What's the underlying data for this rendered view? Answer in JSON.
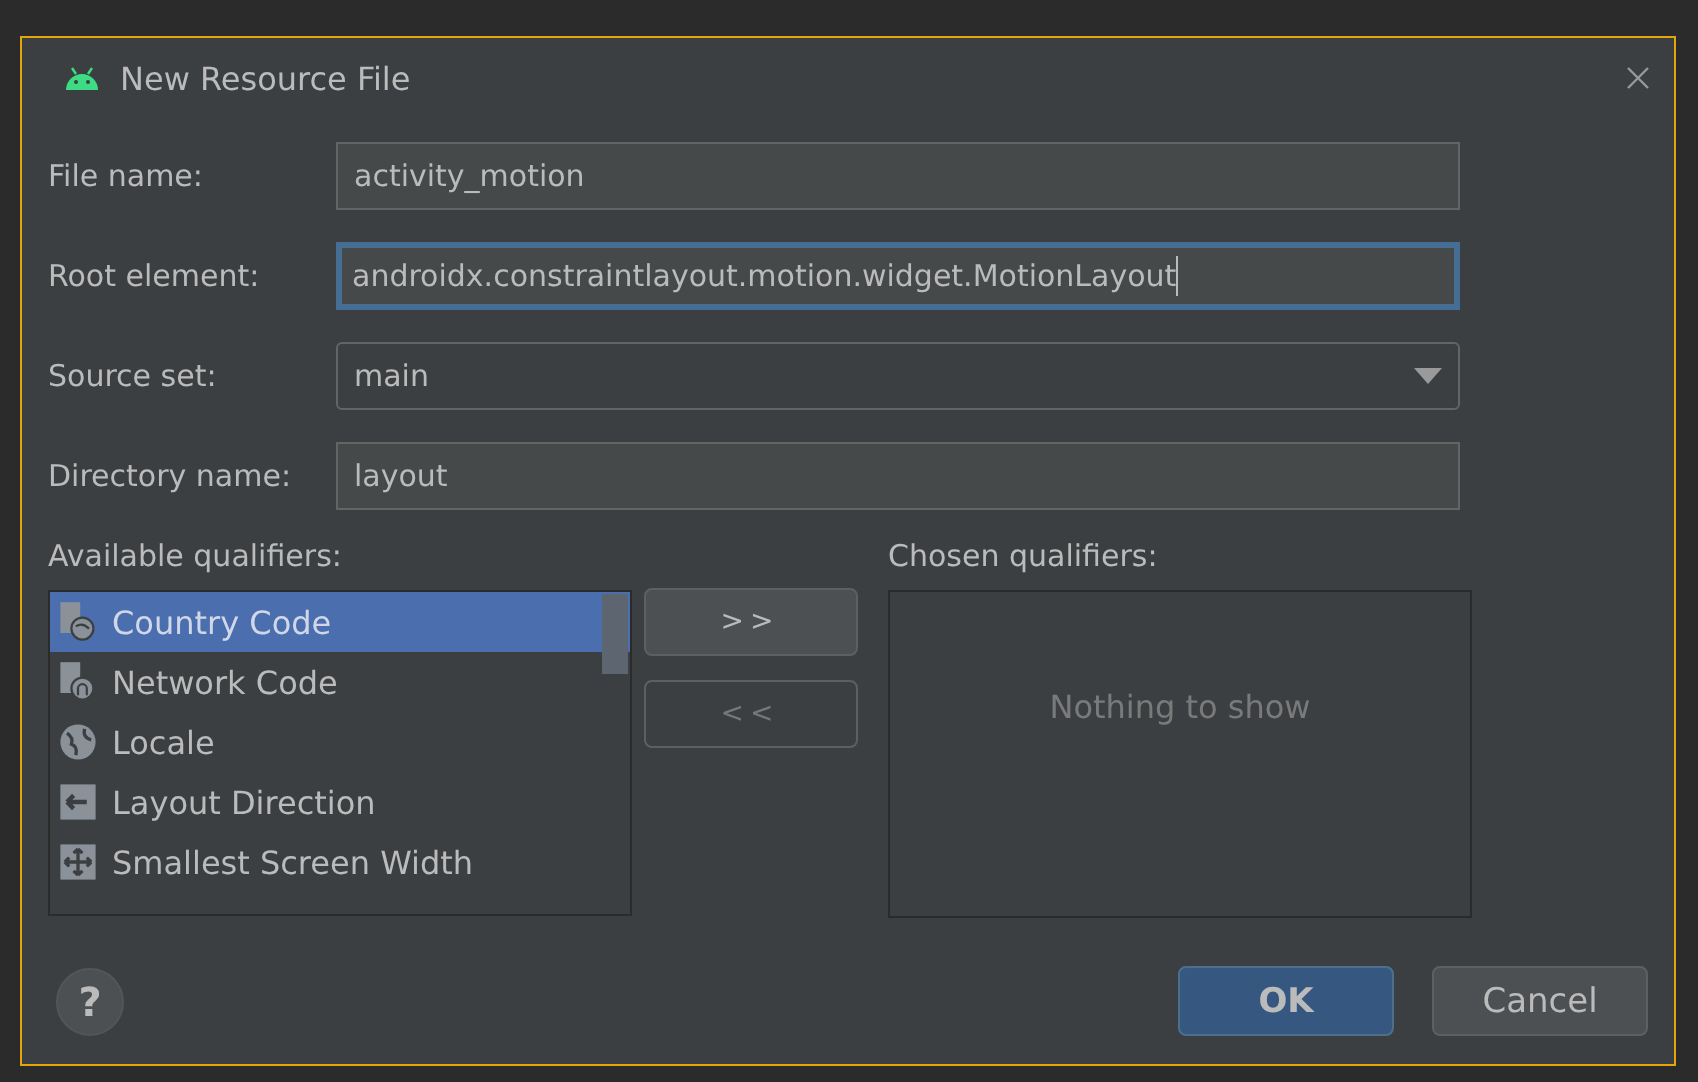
{
  "window": {
    "title": "New Resource File"
  },
  "fields": [
    {
      "label": "File name:",
      "kind": "text",
      "value": "activity_motion",
      "focused": false
    },
    {
      "label": "Root element:",
      "kind": "text",
      "value": "androidx.constraintlayout.motion.widget.MotionLayout",
      "focused": true
    },
    {
      "label": "Source set:",
      "kind": "dropdown",
      "value": "main",
      "focused": false
    },
    {
      "label": "Directory name:",
      "kind": "text",
      "value": "layout",
      "focused": false
    }
  ],
  "available_qualifiers": {
    "label": "Available qualifiers:",
    "items": [
      {
        "label": "Country Code",
        "selected": true
      },
      {
        "label": "Network Code",
        "selected": false
      },
      {
        "label": "Locale",
        "selected": false
      },
      {
        "label": "Layout Direction",
        "selected": false
      },
      {
        "label": "Smallest Screen Width",
        "selected": false
      }
    ]
  },
  "transfer_buttons": [
    {
      "label": ">>",
      "disabled": false
    },
    {
      "label": "<<",
      "disabled": true
    }
  ],
  "chosen_qualifiers": {
    "label": "Chosen qualifiers:",
    "empty_text": "Nothing to show"
  },
  "help_button": {
    "label": "?"
  },
  "buttons": [
    {
      "label": "OK",
      "default": true
    },
    {
      "label": "Cancel",
      "default": false
    }
  ]
}
